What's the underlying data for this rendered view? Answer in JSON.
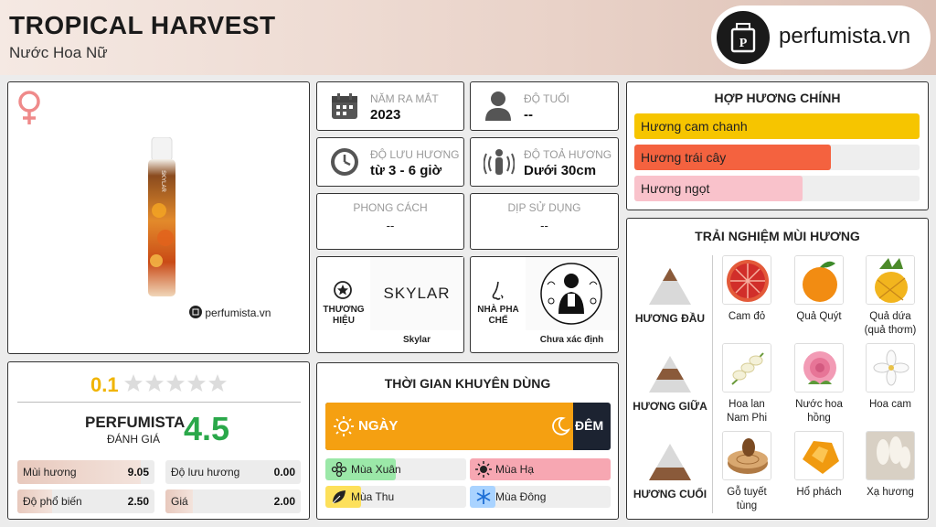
{
  "header": {
    "title": "TROPICAL HARVEST",
    "subtitle": "Nước Hoa Nữ",
    "logo_text": "perfumista.vn"
  },
  "product": {
    "gender_icon": "female-symbol-icon",
    "watermark": "perfumista.vn",
    "bottle_brand": "SKYLAR"
  },
  "info": {
    "launch_year": {
      "label": "NĂM RA MẮT",
      "value": "2023"
    },
    "age": {
      "label": "ĐỘ TUỔI",
      "value": "--"
    },
    "longevity": {
      "label": "ĐỘ LƯU HƯƠNG",
      "value": "từ 3 - 6 giờ"
    },
    "sillage": {
      "label": "ĐỘ TOẢ HƯƠNG",
      "value": "Dưới 30cm"
    },
    "style": {
      "label": "PHONG CÁCH",
      "value": "--"
    },
    "occasion": {
      "label": "DỊP SỬ DỤNG",
      "value": "--"
    },
    "brand": {
      "label_line1": "THƯƠNG",
      "label_line2": "HIỆU",
      "logo": "SKYLAR",
      "name": "Skylar"
    },
    "perfumer": {
      "label_line1": "NHÀ PHA",
      "label_line2": "CHẾ",
      "name": "Chưa xác định"
    }
  },
  "accords": {
    "title": "HỢP HƯƠNG CHÍNH",
    "items": [
      {
        "label": "Hương cam chanh",
        "level": 1.0,
        "color": "#f6c500"
      },
      {
        "label": "Hương trái cây",
        "level": 0.69,
        "color": "#f4623f"
      },
      {
        "label": "Hương ngọt",
        "level": 0.59,
        "color": "#f9c2cb"
      }
    ]
  },
  "rating": {
    "user_score": "0.1",
    "stars_filled": 0,
    "stars_total": 5,
    "brand_label": "PERFUMISTA",
    "brand_sub": "ĐÁNH GIÁ",
    "brand_score": "4.5",
    "metrics": [
      {
        "label": "Mùi hương",
        "value": "9.05",
        "level": 0.9
      },
      {
        "label": "Độ lưu hương",
        "value": "0.00",
        "level": 0.0
      },
      {
        "label": "Độ phổ biến",
        "value": "2.50",
        "level": 0.25
      },
      {
        "label": "Giá",
        "value": "2.00",
        "level": 0.2
      }
    ]
  },
  "time": {
    "title": "THỜI GIAN KHUYÊN DÙNG",
    "day_label": "NGÀY",
    "night_label": "ĐÊM",
    "day_level": 0.87,
    "seasons": [
      {
        "label": "Mùa Xuân",
        "level": 0.5,
        "color": "#9be8a8",
        "icon": "spring-flower-icon"
      },
      {
        "label": "Mùa Hạ",
        "level": 1.0,
        "color": "#f7a7b2",
        "icon": "summer-sun-icon"
      },
      {
        "label": "Mùa Thu",
        "level": 0.25,
        "color": "#fde05a",
        "icon": "autumn-leaf-icon"
      },
      {
        "label": "Mùa Đông",
        "level": 0.18,
        "color": "#a9d3ff",
        "icon": "winter-snowflake-icon"
      }
    ]
  },
  "notes": {
    "title": "TRẢI NGHIỆM MÙI HƯƠNG",
    "top": {
      "label": "HƯƠNG ĐẦU",
      "items": [
        {
          "name_l1": "Cam đỏ",
          "name_l2": "",
          "icon": "blood-orange-image"
        },
        {
          "name_l1": "Quả Quýt",
          "name_l2": "",
          "icon": "tangerine-image"
        },
        {
          "name_l1": "Quả dứa",
          "name_l2": "(quả thơm)",
          "icon": "pineapple-image"
        }
      ]
    },
    "middle": {
      "label": "HƯƠNG GIỮA",
      "items": [
        {
          "name_l1": "Hoa lan",
          "name_l2": "Nam Phi",
          "icon": "freesia-image"
        },
        {
          "name_l1": "Nước hoa",
          "name_l2": "hồng",
          "icon": "rose-image"
        },
        {
          "name_l1": "Hoa cam",
          "name_l2": "",
          "icon": "orange-blossom-image"
        }
      ]
    },
    "base": {
      "label": "HƯƠNG CUỐI",
      "items": [
        {
          "name_l1": "Gỗ tuyết",
          "name_l2": "tùng",
          "icon": "cedar-wood-image"
        },
        {
          "name_l1": "Hổ phách",
          "name_l2": "",
          "icon": "amber-image"
        },
        {
          "name_l1": "Xạ hương",
          "name_l2": "",
          "icon": "musk-image"
        }
      ]
    }
  }
}
